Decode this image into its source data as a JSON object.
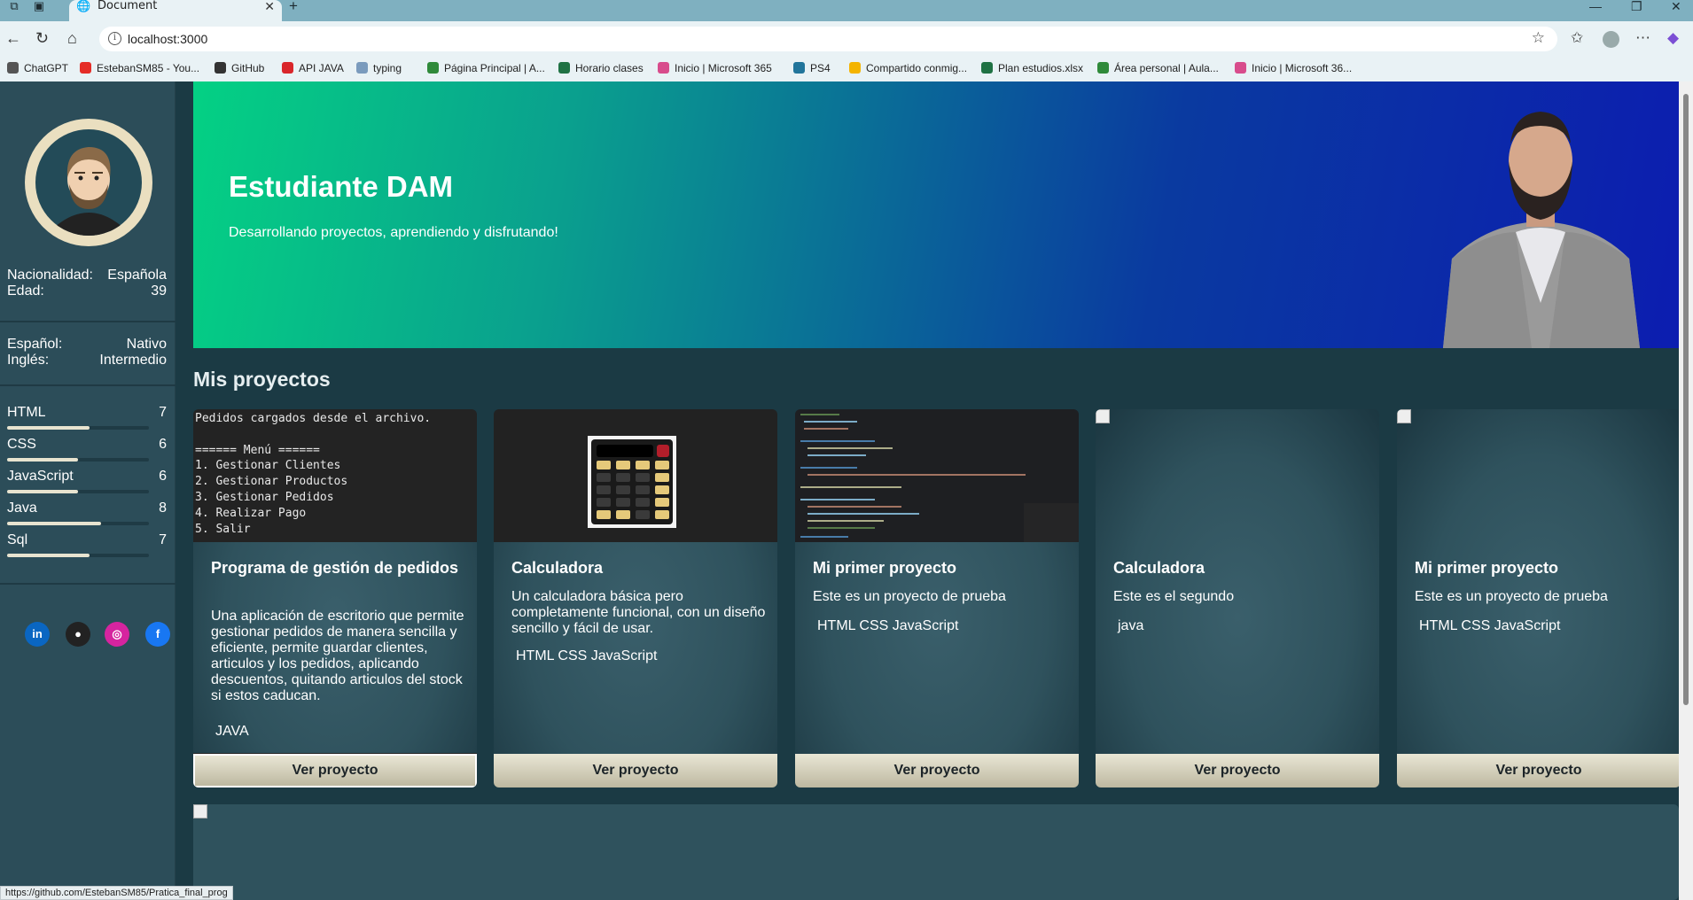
{
  "browser": {
    "tab_title": "Document",
    "url": "localhost:3000",
    "status_url": "https://github.com/EstebanSM85/Pratica_final_prog",
    "bookmarks": [
      {
        "label": "ChatGPT",
        "color": "#555555"
      },
      {
        "label": "EstebanSM85 - You...",
        "color": "#e52d27"
      },
      {
        "label": "GitHub",
        "color": "#333333"
      },
      {
        "label": "API JAVA",
        "color": "#d9262b"
      },
      {
        "label": "typing",
        "color": "#7a9bbd"
      },
      {
        "label": "Página Principal | A...",
        "color": "#2f8a3a"
      },
      {
        "label": "Horario clases",
        "color": "#1f7244"
      },
      {
        "label": "Inicio | Microsoft 365",
        "color": "#d84c8c"
      },
      {
        "label": "PS4",
        "color": "#21759b"
      },
      {
        "label": "Compartido conmig...",
        "color": "#f4b400"
      },
      {
        "label": "Plan estudios.xlsx",
        "color": "#1f7244"
      },
      {
        "label": "Área personal | Aula...",
        "color": "#2f8a3a"
      },
      {
        "label": "Inicio | Microsoft 36...",
        "color": "#d84c8c"
      }
    ]
  },
  "sidebar": {
    "info": [
      {
        "label": "Nacionalidad:",
        "value": "Española"
      },
      {
        "label": "Edad:",
        "value": "39"
      }
    ],
    "languages": [
      {
        "label": "Español:",
        "value": "Nativo"
      },
      {
        "label": "Inglés:",
        "value": "Intermedio"
      }
    ],
    "skills": [
      {
        "name": "HTML",
        "level": "7",
        "fraction": 0.58
      },
      {
        "name": "CSS",
        "level": "6",
        "fraction": 0.5
      },
      {
        "name": "JavaScript",
        "level": "6",
        "fraction": 0.5
      },
      {
        "name": "Java",
        "level": "8",
        "fraction": 0.66
      },
      {
        "name": "Sql",
        "level": "7",
        "fraction": 0.58
      }
    ],
    "social": [
      {
        "icon": "linkedin-icon",
        "glyph": "in",
        "color": "#0a66c2"
      },
      {
        "icon": "github-icon",
        "glyph": "●",
        "color": "#222222"
      },
      {
        "icon": "instagram-icon",
        "glyph": "◎",
        "color": "#d6249f"
      },
      {
        "icon": "facebook-icon",
        "glyph": "f",
        "color": "#1877f2"
      }
    ]
  },
  "hero": {
    "title": "Estudiante DAM",
    "subtitle": "Desarrollando proyectos, aprendiendo y disfrutando!"
  },
  "projects": {
    "section_title": "Mis proyectos",
    "button_label": "Ver proyecto",
    "terminal_lines": [
      "Pedidos cargados desde el archivo.",
      "",
      "====== Menú ======",
      "1. Gestionar Clientes",
      "2. Gestionar Productos",
      "3. Gestionar Pedidos",
      "4. Realizar Pago",
      "5. Salir"
    ],
    "cards": [
      {
        "title": "Programa de gestión de pedidos",
        "description": "Una aplicación de escritorio que permite gestionar pedidos de manera sencilla y eficiente, permite guardar clientes, articulos y los pedidos, aplicando descuentos, quitando articulos del stock si estos caducan.",
        "tech": "JAVA"
      },
      {
        "title": "Calculadora",
        "description": "Un calculadora básica pero completamente funcional, con un diseño sencillo y fácil de usar.",
        "tech": "HTML CSS JavaScript"
      },
      {
        "title": "Mi primer proyecto",
        "description": "Este es un proyecto de prueba",
        "tech": "HTML CSS JavaScript"
      },
      {
        "title": "Calculadora",
        "description": "Este es el segundo",
        "tech": "java"
      },
      {
        "title": "Mi primer proyecto",
        "description": "Este es un proyecto de prueba",
        "tech": "HTML CSS JavaScript"
      }
    ]
  }
}
